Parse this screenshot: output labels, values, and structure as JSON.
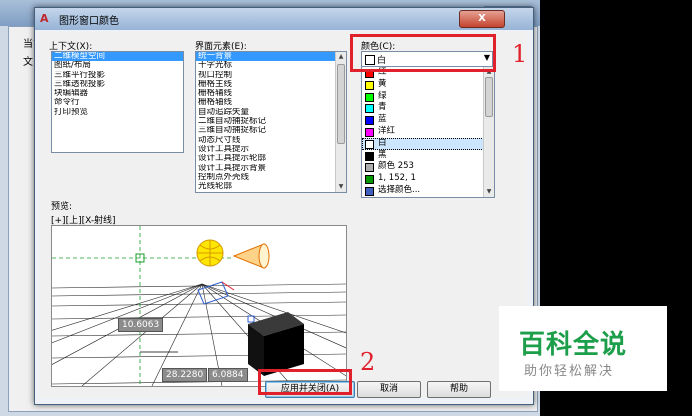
{
  "background_window": {
    "tabs": [
      "当前",
      "文"
    ]
  },
  "dialog": {
    "title": "图形窗口颜色",
    "close_label": "X"
  },
  "context": {
    "label": "上下文(X):",
    "items": [
      "二维模型空间",
      "图纸/布局",
      "三维平行投影",
      "三维透视投影",
      "块编辑器",
      "命令行",
      "打印预览"
    ],
    "selected_index": 0
  },
  "interface": {
    "label": "界面元素(E):",
    "items": [
      "统一背景",
      "十字光标",
      "视口控制",
      "栅格主线",
      "栅格辅线",
      "栅格轴线",
      "自动追踪矢量",
      "二维自动捕捉标记",
      "三维自动捕捉标记",
      "动态尺寸线",
      "设计工具提示",
      "设计工具提示轮廓",
      "设计工具提示背景",
      "控制点外壳线",
      "光线轮廓"
    ],
    "selected_index": 0
  },
  "color": {
    "label": "颜色(C):",
    "current_value": "白",
    "current_swatch": "#ffffff",
    "options": [
      {
        "name": "红",
        "swatch": "#ff0000"
      },
      {
        "name": "黄",
        "swatch": "#ffff00"
      },
      {
        "name": "绿",
        "swatch": "#00ff00"
      },
      {
        "name": "青",
        "swatch": "#00ffff"
      },
      {
        "name": "蓝",
        "swatch": "#0000ff"
      },
      {
        "name": "洋红",
        "swatch": "#ff00ff"
      },
      {
        "name": "白",
        "swatch": "#ffffff"
      },
      {
        "name": "黑",
        "swatch": "#000000"
      },
      {
        "name": "颜色 253",
        "swatch": "#adadad"
      },
      {
        "name": "1, 152, 1",
        "swatch": "#019801"
      },
      {
        "name": "选择颜色...",
        "swatch": "#4060c0"
      }
    ],
    "highlighted_index": 6
  },
  "preview": {
    "label": "预览:",
    "viewport_label": "[+][上][X-射线]",
    "dim1": "10.6063",
    "dim2": "28.2280",
    "dim3": "6.0884"
  },
  "buttons": {
    "apply_close": "应用并关闭(A)",
    "cancel": "取消",
    "help": "帮助"
  },
  "annotations": {
    "step1": "1",
    "step2": "2"
  },
  "watermark": {
    "main": "百科全说",
    "sub": "助你轻松解决"
  }
}
